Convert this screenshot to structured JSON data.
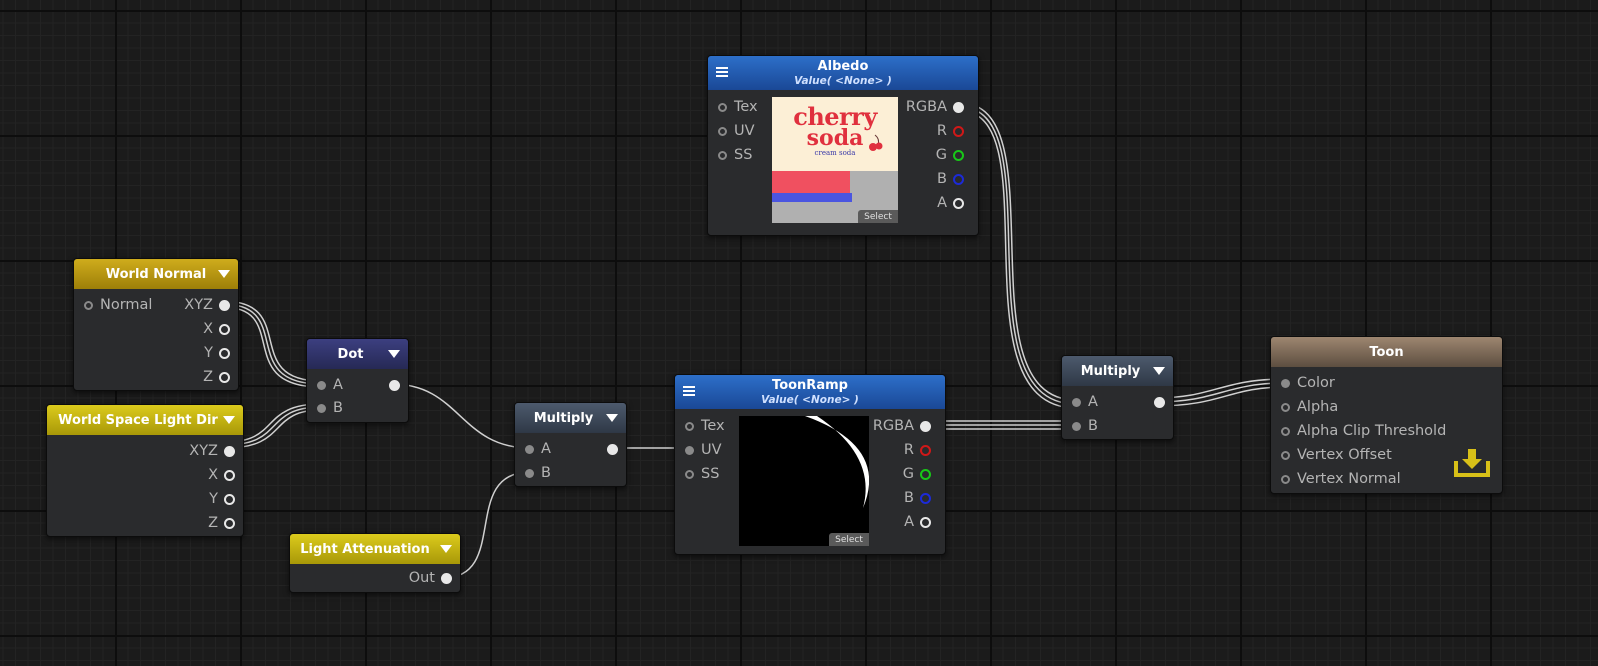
{
  "nodes": {
    "world_normal": {
      "title": "World Normal",
      "inputs": [
        "Normal"
      ],
      "outputs": [
        "XYZ",
        "X",
        "Y",
        "Z"
      ]
    },
    "light_dir": {
      "title": "World Space Light Dir",
      "outputs": [
        "XYZ",
        "X",
        "Y",
        "Z"
      ]
    },
    "dot": {
      "title": "Dot",
      "inputs": [
        "A",
        "B"
      ]
    },
    "light_attenuation": {
      "title": "Light Attenuation",
      "outputs": [
        "Out"
      ]
    },
    "multiply1": {
      "title": "Multiply",
      "inputs": [
        "A",
        "B"
      ]
    },
    "toonramp": {
      "title": "ToonRamp",
      "subtitle": "Value( <None> )",
      "inputs": [
        "Tex",
        "UV",
        "SS"
      ],
      "outputs": [
        "RGBA",
        "R",
        "G",
        "B",
        "A"
      ],
      "select_label": "Select"
    },
    "albedo": {
      "title": "Albedo",
      "subtitle": "Value( <None> )",
      "inputs": [
        "Tex",
        "UV",
        "SS"
      ],
      "outputs": [
        "RGBA",
        "R",
        "G",
        "B",
        "A"
      ],
      "select_label": "Select",
      "texture_text": {
        "line1": "cherry",
        "line2": "soda",
        "line3": "cream soda"
      }
    },
    "multiply2": {
      "title": "Multiply",
      "inputs": [
        "A",
        "B"
      ]
    },
    "toon": {
      "title": "Toon",
      "inputs": [
        "Color",
        "Alpha",
        "Alpha Clip Threshold",
        "Vertex Offset",
        "Vertex Normal"
      ]
    }
  },
  "icons": {
    "node_menu": "hamburger-menu-icon",
    "collapse": "triangle-down-icon",
    "save": "download-tray-icon"
  },
  "colors": {
    "canvas": "#1b1b1b",
    "header_yellow": "#c2a011",
    "header_purple": "#2f3269",
    "header_slate": "#3e4858",
    "header_blue": "#2259b0",
    "header_brown": "#7d6b59",
    "port_r": "#d01818",
    "port_g": "#18c818",
    "port_b": "#1c2ad8",
    "wire": "#cfcfcf",
    "save_icon": "#d8c018"
  }
}
